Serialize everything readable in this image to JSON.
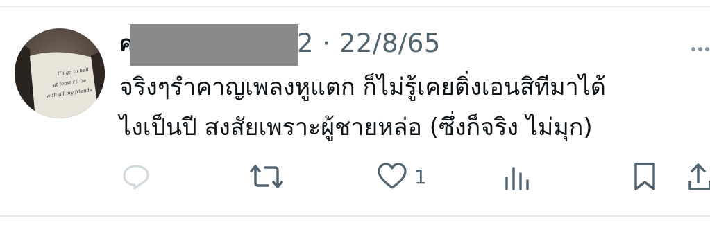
{
  "tweet": {
    "author_initial": "ค",
    "meta_text": "2 · 22/8/65",
    "text_lines": [
      "จริงๆรำคาญเพลงหูแตก ก็ไม่รู้เคยติ่งเอนสิทีมาได้",
      "ไงเป็นปี สงสัยเพราะผู้ชายหล่อ (ซึ่งก็จริง ไม่มุก)"
    ],
    "avatar_text": [
      "If i go to hell",
      "at least i'll be",
      "with all my friends"
    ]
  },
  "actions": {
    "reply": {
      "icon": "reply-icon"
    },
    "retweet": {
      "icon": "retweet-icon"
    },
    "like": {
      "icon": "heart-icon",
      "count": "1"
    },
    "views": {
      "icon": "views-icon"
    },
    "bookmark": {
      "icon": "bookmark-icon"
    },
    "share": {
      "icon": "share-icon"
    }
  },
  "colors": {
    "text": "#0f1419",
    "muted": "#536471",
    "reply_faded": "#cfd9de",
    "divider": "#e6e9ec",
    "redaction": "#8a8a8c"
  }
}
